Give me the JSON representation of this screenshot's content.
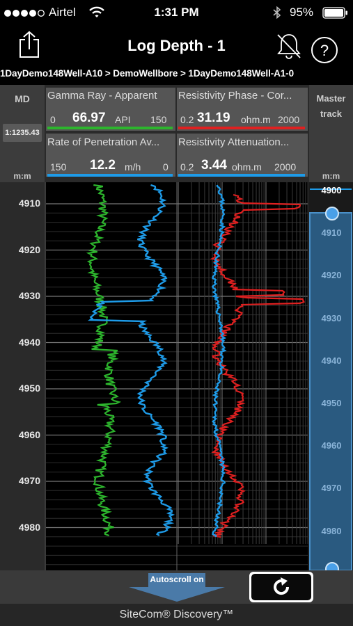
{
  "status_bar": {
    "carrier": "Airtel",
    "time": "1:31 PM",
    "battery": "95%"
  },
  "nav": {
    "title": "Log Depth - 1"
  },
  "breadcrumb": "1DayDemo148Well-A10 > DemoWellbore > 1DayDemo148Well-A1-0",
  "header": {
    "md_label": "MD",
    "scale": "1:1235.43",
    "unit_left": "m:m",
    "master_track_line1": "Master",
    "master_track_line2": "track",
    "unit_right": "m:m",
    "curves": [
      {
        "name": "Gamma Ray - Apparent",
        "min": "0",
        "value": "66.97",
        "unit": "API",
        "max": "150",
        "color": "#2db52d"
      },
      {
        "name": "Resistivity Phase - Cor...",
        "min": "0.2",
        "value": "31.19",
        "unit": "ohm.m",
        "max": "2000",
        "color": "#e02020"
      },
      {
        "name": "Rate of Penetration Av...",
        "min": "150",
        "value": "12.2",
        "unit": "m/h",
        "max": "0",
        "color": "#1e9be8"
      },
      {
        "name": "Resistivity Attenuation...",
        "min": "0.2",
        "value": "3.44",
        "unit": "ohm.m",
        "max": "2000",
        "color": "#1e9be8"
      }
    ]
  },
  "depth_ticks": [
    "4910",
    "4920",
    "4930",
    "4940",
    "4950",
    "4960",
    "4970",
    "4980"
  ],
  "master_ticks": [
    "4900",
    "4910",
    "4920",
    "4930",
    "4940",
    "4950",
    "4960",
    "4970",
    "4980"
  ],
  "bottom": {
    "autoscroll_label": "Autoscroll on"
  },
  "footer": "SiteCom® Discovery™"
}
